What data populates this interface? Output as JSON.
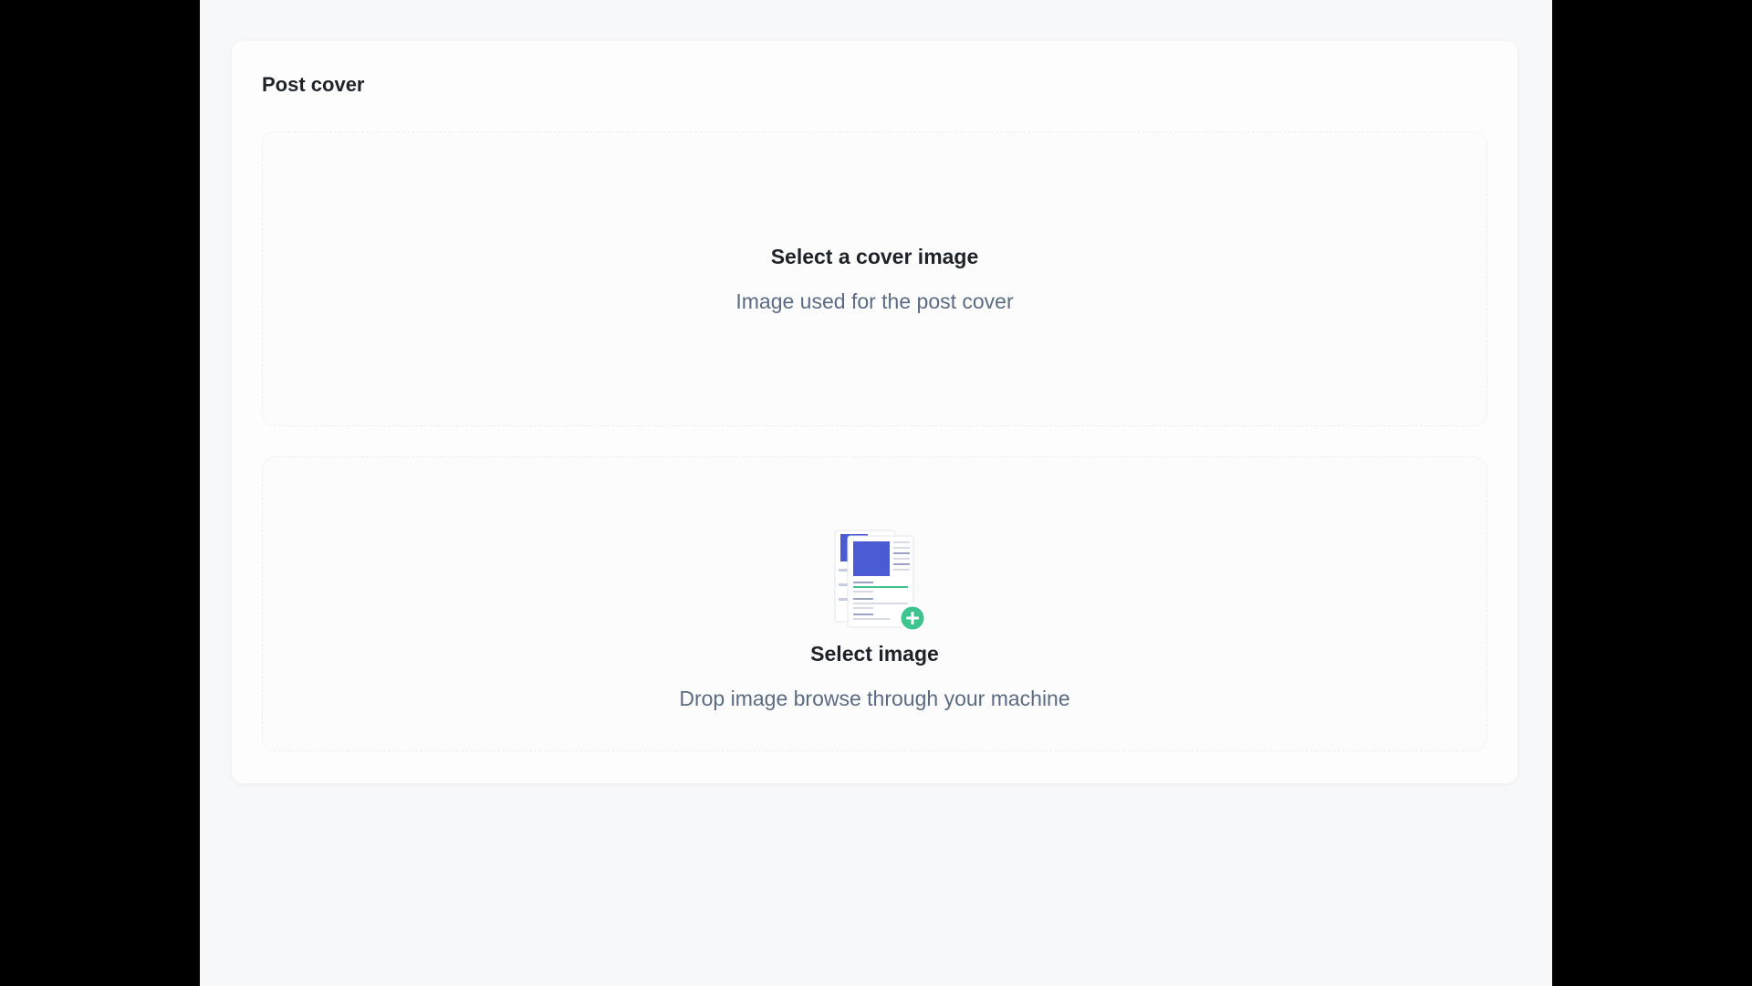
{
  "post_cover": {
    "title": "Post cover",
    "cover_zone": {
      "heading": "Select a cover image",
      "subtext": "Image used for the post cover"
    },
    "upload_zone": {
      "icon": "image-upload-icon",
      "heading": "Select image",
      "subtext": "Drop image browse through your machine"
    }
  },
  "colors": {
    "accent_blue": "#4a5bd4",
    "accent_green": "#3ec48f",
    "muted_text": "#5b6b82",
    "heading_text": "#1f2329"
  }
}
